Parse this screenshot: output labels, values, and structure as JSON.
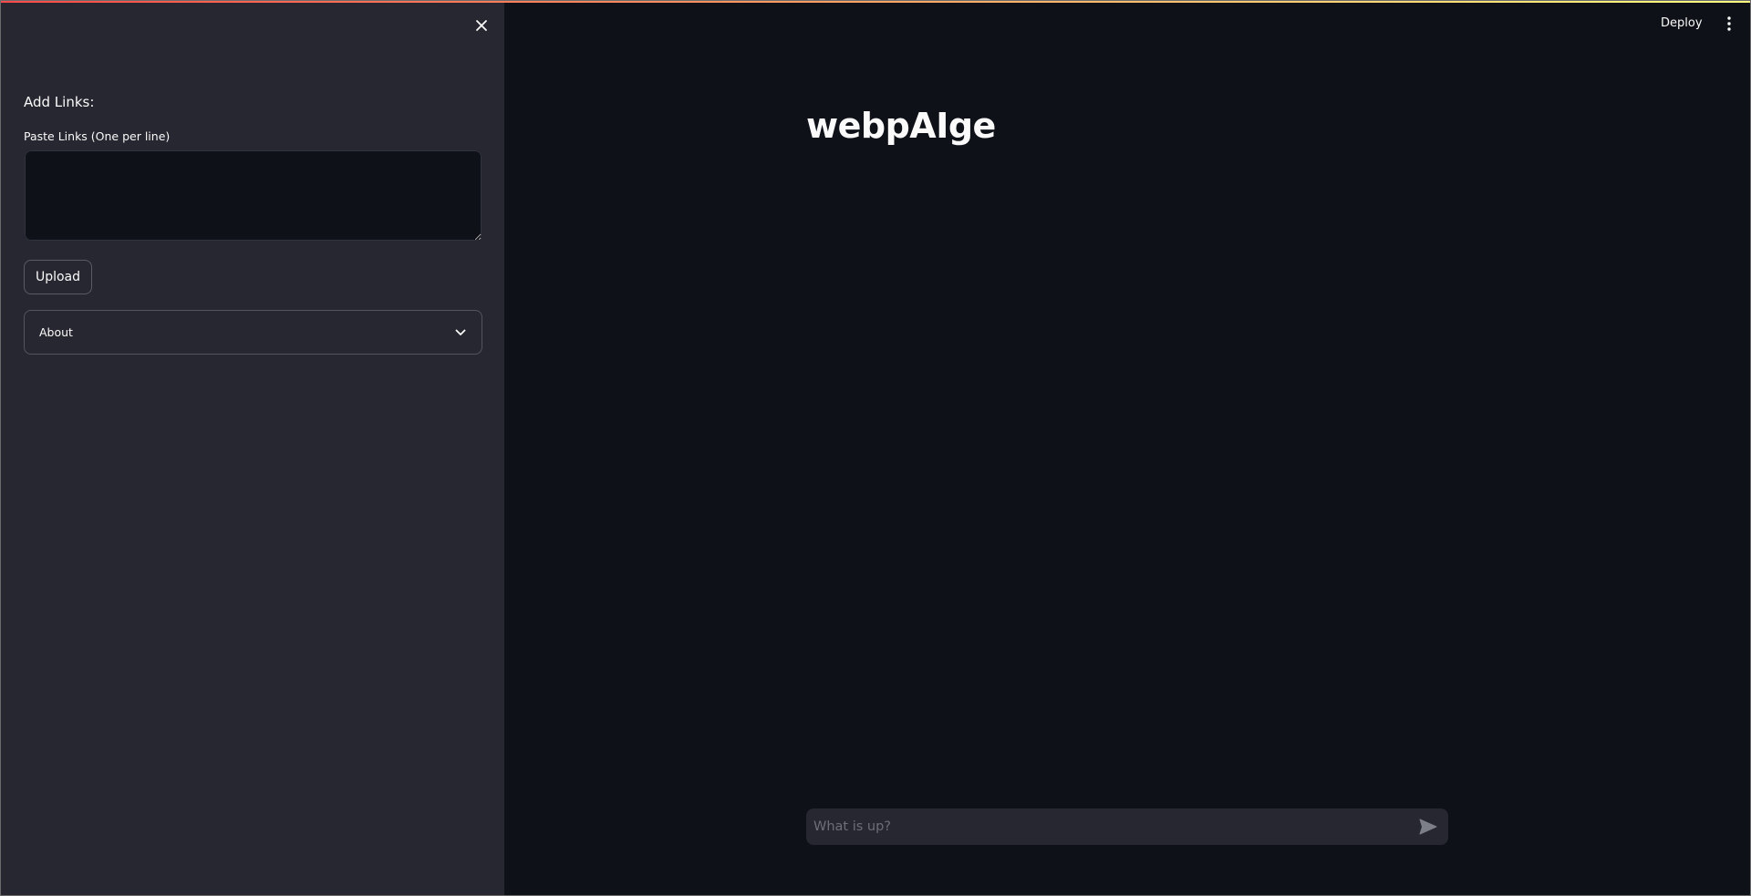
{
  "sidebar": {
    "close_icon": "close-icon",
    "section_heading": "Add Links:",
    "links_label": "Paste Links (One per line)",
    "links_value": "",
    "upload_label": "Upload",
    "about_label": "About",
    "about_icon": "chevron-down-icon"
  },
  "header": {
    "deploy_label": "Deploy",
    "menu_icon": "vertical-dots-icon"
  },
  "main": {
    "title": "webpAIge",
    "chat_placeholder": "What is up?",
    "send_icon": "send-icon"
  },
  "colors": {
    "background": "#0e1117",
    "sidebar": "#262730",
    "text": "#fafafa",
    "accent_gradient_start": "#ff4b4b",
    "accent_gradient_end": "#fffd80"
  }
}
